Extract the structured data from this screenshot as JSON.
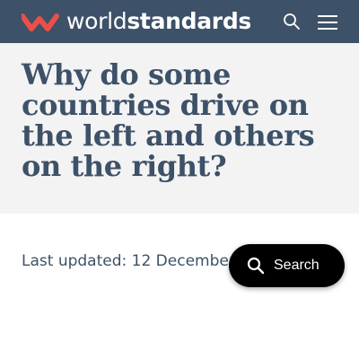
{
  "header": {
    "brand_light": "world",
    "brand_bold": "standards",
    "background": "#3d5168",
    "logo_mark_color": "#e8504a",
    "search_icon": "search-icon",
    "menu_icon": "hamburger-menu-icon"
  },
  "article": {
    "title": "Why do some countries drive on the left and others on the right?",
    "last_updated": "Last updated: 12 December 2",
    "title_color": "#3d5168"
  },
  "search_widget": {
    "label": "Search",
    "icon": "search-icon",
    "background": "#000000"
  }
}
